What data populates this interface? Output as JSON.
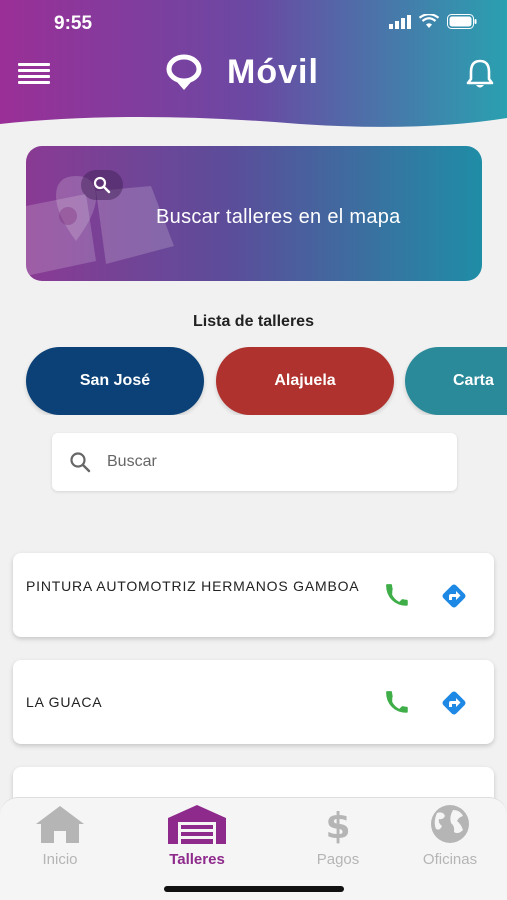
{
  "status_bar": {
    "time": "9:55"
  },
  "header": {
    "brand": "Móvil"
  },
  "map_banner": {
    "label": "Buscar talleres en el mapa"
  },
  "list": {
    "title": "Lista de talleres"
  },
  "provinces": [
    "San José",
    "Alajuela",
    "Carta"
  ],
  "search": {
    "placeholder": "Buscar"
  },
  "workshops": [
    {
      "name": "PINTURA AUTOMOTRIZ HERMANOS GAMBOA"
    },
    {
      "name": "LA GUACA"
    }
  ],
  "nav": {
    "inicio": "Inicio",
    "talleres": "Talleres",
    "pagos": "Pagos",
    "oficinas": "Oficinas"
  },
  "colors": {
    "header_gradient": [
      "#9a2f97",
      "#2aa0b0"
    ],
    "san_jose": "#0b4177",
    "alajuela": "#b0322e",
    "cartago": "#2a8a9a",
    "phone_icon": "#3fae49",
    "directions_icon": "#1e88e5",
    "active_nav": "#8e2a8c"
  }
}
